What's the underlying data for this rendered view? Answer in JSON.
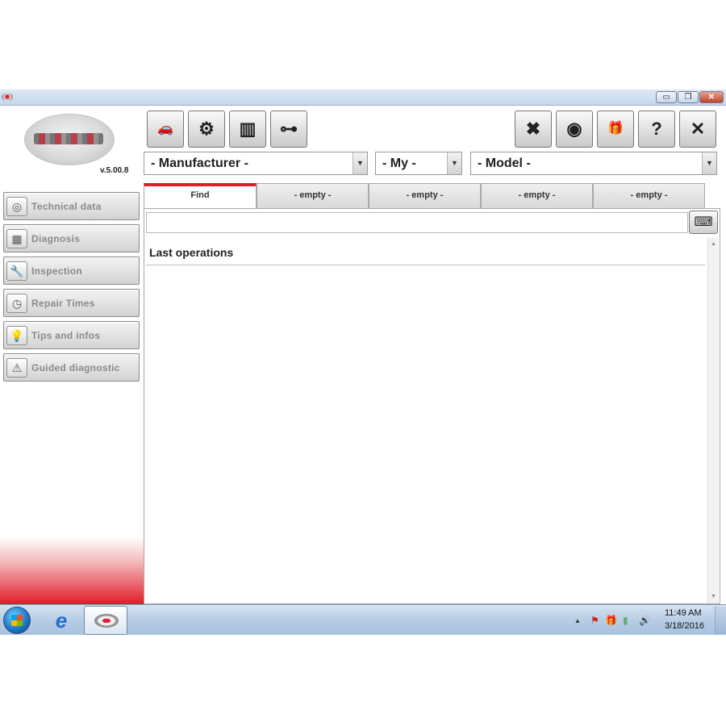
{
  "window": {
    "min_glyph": "▭",
    "max_glyph": "❐",
    "close_glyph": "✕"
  },
  "app": {
    "version": "v.5.00.8"
  },
  "sidebar": {
    "items": [
      {
        "label": "Technical data",
        "icon": "steering-wheel-icon",
        "glyph": "◎"
      },
      {
        "label": "Diagnosis",
        "icon": "diagnosis-icon",
        "glyph": "▦"
      },
      {
        "label": "Inspection",
        "icon": "wrench-icon",
        "glyph": "🔧"
      },
      {
        "label": "Repair Times",
        "icon": "clock-icon",
        "glyph": "◷"
      },
      {
        "label": "Tips and infos",
        "icon": "lightbulb-icon",
        "glyph": "💡"
      },
      {
        "label": "Guided diagnostic",
        "icon": "warning-probe-icon",
        "glyph": "⚠"
      }
    ]
  },
  "toolbar": {
    "left": [
      {
        "icon": "cars-icon",
        "glyph": "🚗"
      },
      {
        "icon": "engine-icon",
        "glyph": "⚙"
      },
      {
        "icon": "battery-icon",
        "glyph": "▥"
      },
      {
        "icon": "connector-icon",
        "glyph": "⊶"
      }
    ],
    "right": [
      {
        "icon": "tools-icon",
        "glyph": "✖"
      },
      {
        "icon": "sync-icon",
        "glyph": "◉"
      },
      {
        "icon": "gift-icon",
        "glyph": "🎁"
      },
      {
        "icon": "help-icon",
        "glyph": "?"
      },
      {
        "icon": "close-icon",
        "glyph": "✕"
      }
    ]
  },
  "dropdowns": {
    "manufacturer": "- Manufacturer -",
    "my": "- My -",
    "model": "- Model -",
    "arrow": "▼"
  },
  "tabs": [
    {
      "label": "Find",
      "active": true
    },
    {
      "label": "-  empty  -",
      "active": false
    },
    {
      "label": "-  empty  -",
      "active": false
    },
    {
      "label": "-  empty  -",
      "active": false
    },
    {
      "label": "-  empty  -",
      "active": false
    }
  ],
  "search": {
    "value": "",
    "keyboard_glyph": "⌨"
  },
  "last_operations": {
    "title": "Last operations"
  },
  "scroll": {
    "up": "▲",
    "down": "▼"
  },
  "taskbar": {
    "ie_glyph": "e",
    "tray": {
      "chevron": "▲",
      "flag": "⚑",
      "gift": "🎁",
      "network": "▮",
      "volume": "🔊"
    },
    "clock": {
      "time": "11:49 AM",
      "date": "3/18/2016"
    }
  }
}
